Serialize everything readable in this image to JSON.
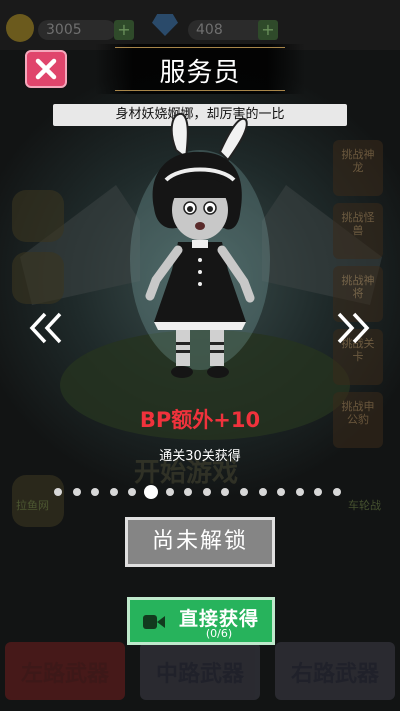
{
  "background": {
    "coins_value": "3005",
    "gems_value": "408",
    "side_cards": [
      "挑战神龙",
      "挑战怪兽",
      "挑战神将",
      "挑战关卡",
      "挑战申公豹"
    ],
    "bottom_buttons": [
      "左路武器",
      "中路武器",
      "右路武器"
    ],
    "label_left_bottom": "拉鱼网",
    "label_right_bottom": "车轮战",
    "banner_partial": "开始游戏"
  },
  "dialog": {
    "title": "服务员",
    "subtitle": "身材妖娆婀娜，却厉害的一比",
    "reward_text": "BP额外+10",
    "unlock_condition": "通关30关获得",
    "page_count": 16,
    "current_page": 6,
    "locked_label": "尚未解锁",
    "get_button": {
      "label": "直接获得",
      "progress": "(0/6)"
    }
  },
  "colors": {
    "close_button": "#e0456c",
    "reward_text": "#f0323c",
    "get_button": "#27b35c",
    "locked_button": "#858585"
  },
  "icons": {
    "close": "close-icon",
    "prev": "chevron-left-icon",
    "next": "chevron-right-icon",
    "video": "video-camera-icon"
  }
}
